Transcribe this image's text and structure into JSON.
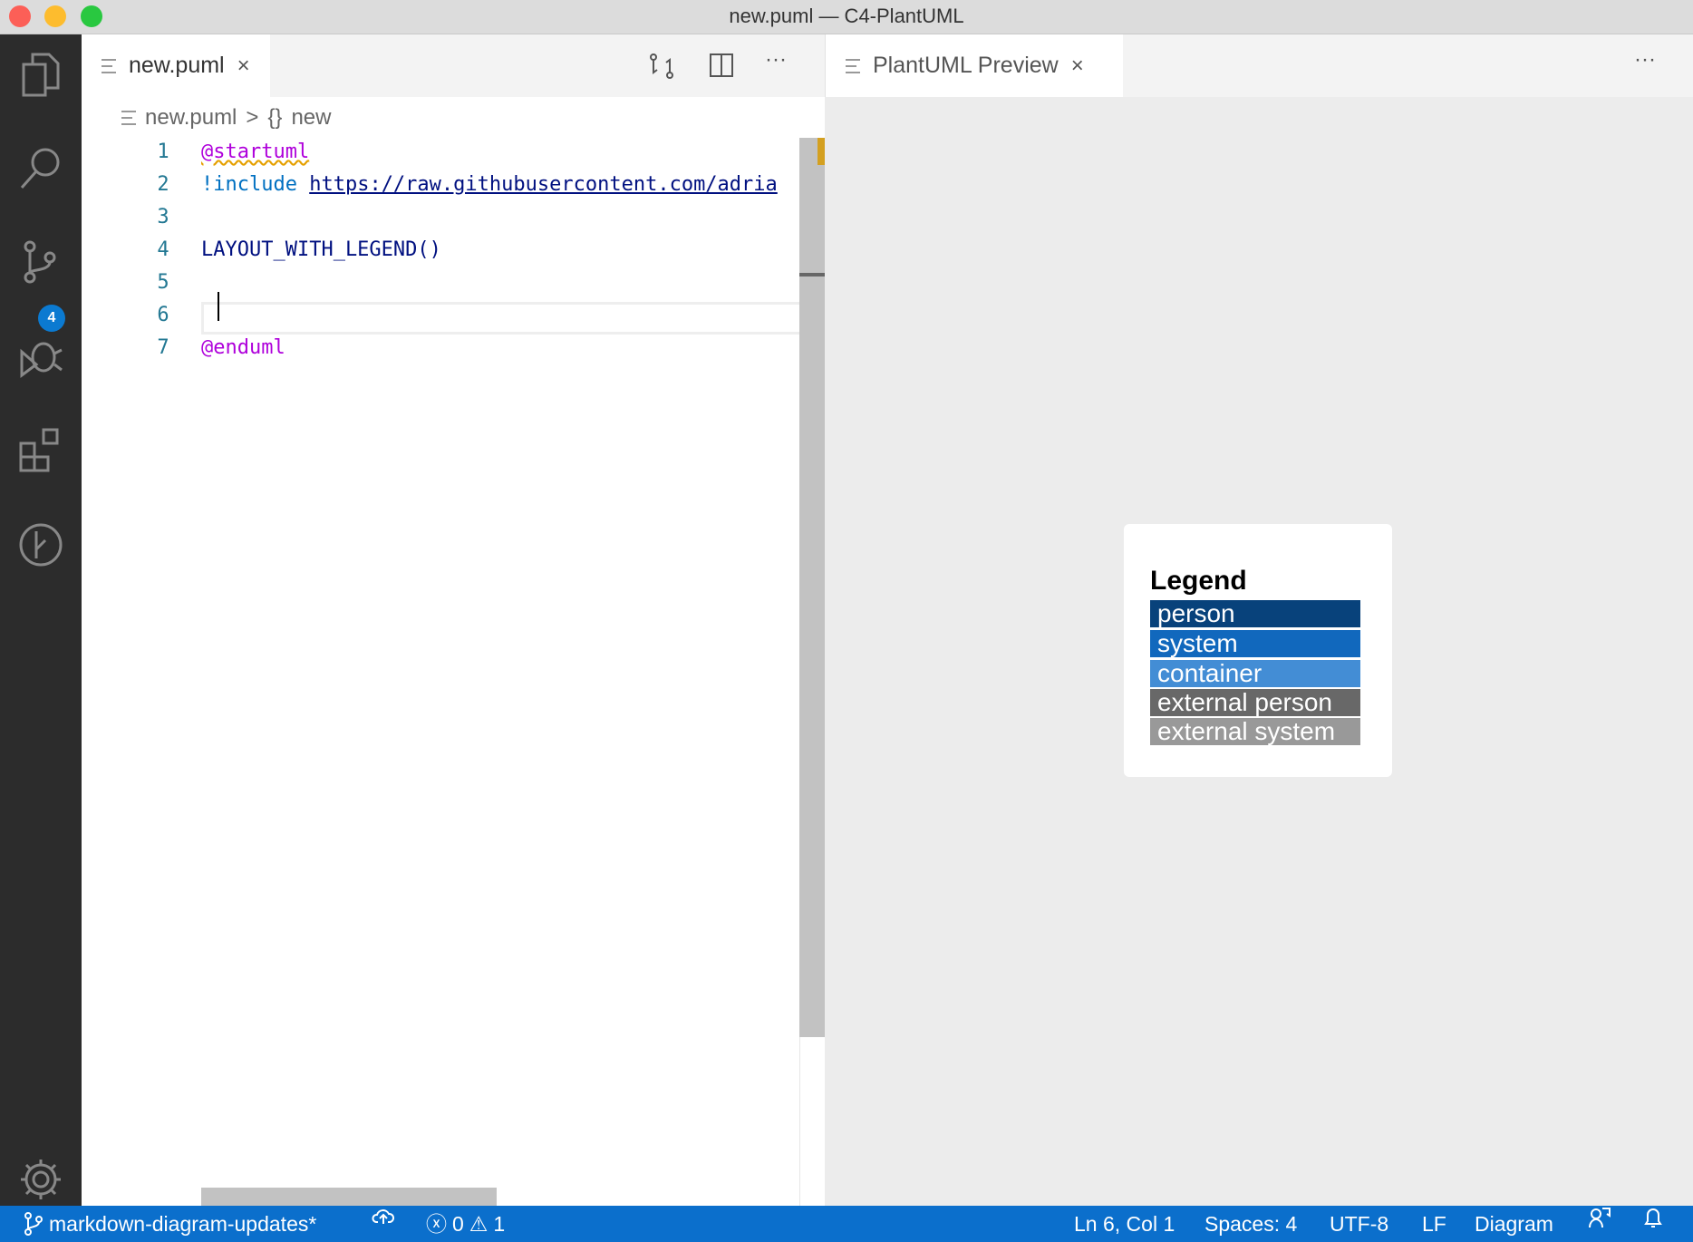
{
  "window": {
    "title": "new.puml — C4-PlantUML"
  },
  "activity_bar": {
    "items": [
      "explorer",
      "search",
      "source-control",
      "debug",
      "extensions",
      "git-graph"
    ],
    "scm_badge": "4"
  },
  "editor": {
    "tab": {
      "label": "new.puml",
      "close": "×"
    },
    "toolbar": {
      "more": "···"
    },
    "breadcrumb": {
      "file": "new.puml",
      "sep": ">",
      "symbol_icon": "{}",
      "symbol": "new"
    },
    "lines": [
      {
        "n": "1",
        "text": "@startuml"
      },
      {
        "n": "2",
        "kw": "!include",
        "url": "https://raw.githubusercontent.com/adria"
      },
      {
        "n": "3",
        "text": ""
      },
      {
        "n": "4",
        "text": "LAYOUT_WITH_LEGEND()"
      },
      {
        "n": "5",
        "text": ""
      },
      {
        "n": "6",
        "text": ""
      },
      {
        "n": "7",
        "text": "@enduml"
      }
    ]
  },
  "preview": {
    "tab": {
      "label": "PlantUML Preview",
      "close": "×"
    },
    "more": "···",
    "legend": {
      "title": "Legend",
      "items": [
        {
          "label": "person",
          "color": "#08427b"
        },
        {
          "label": "system",
          "color": "#1168bd"
        },
        {
          "label": "container",
          "color": "#438dd5"
        },
        {
          "label": "external person",
          "color": "#686868"
        },
        {
          "label": "external system",
          "color": "#999999"
        }
      ]
    }
  },
  "status": {
    "branch": "markdown-diagram-updates*",
    "errors": "0",
    "warnings": "1",
    "position": "Ln 6, Col 1",
    "spaces": "Spaces: 4",
    "encoding": "UTF-8",
    "eol": "LF",
    "language": "Diagram",
    "color": "#0b6fcc"
  }
}
